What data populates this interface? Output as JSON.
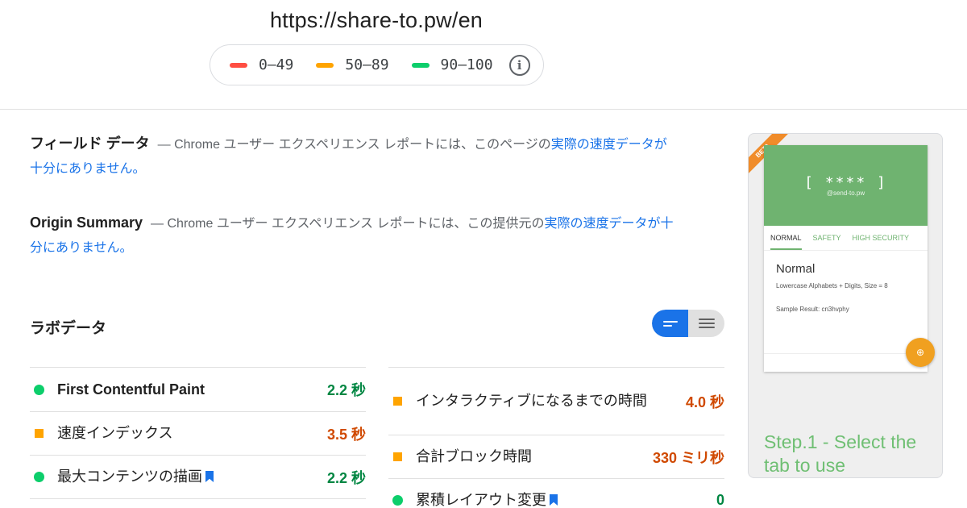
{
  "header": {
    "url": "https://share-to.pw/en"
  },
  "legend": {
    "items": [
      {
        "label": "0–49",
        "color": "#ff4e42"
      },
      {
        "label": "50–89",
        "color": "#ffa400"
      },
      {
        "label": "90–100",
        "color": "#0cce6b"
      }
    ],
    "info_icon_glyph": "i"
  },
  "field_data": {
    "title": "フィールド データ",
    "text": "— Chrome ユーザー エクスペリエンス レポートには、このページの",
    "link": "実際の速度データが十分にありません。"
  },
  "origin_summary": {
    "title": "Origin Summary",
    "text": "— Chrome ユーザー エクスペリエンス レポートには、この提供元の",
    "link": "実際の速度データが十分にありません。"
  },
  "lab_data": {
    "title": "ラボデータ"
  },
  "metrics_left": [
    {
      "name": "First Contentful Paint",
      "value": "2.2 秒",
      "status": "green",
      "bookmark": false
    },
    {
      "name": "速度インデックス",
      "value": "3.5 秒",
      "status": "orange",
      "bookmark": false
    },
    {
      "name": "最大コンテンツの描画",
      "value": "2.2 秒",
      "status": "green",
      "bookmark": true
    }
  ],
  "metrics_right": [
    {
      "name": "インタラクティブになるまでの時間",
      "value": "4.0 秒",
      "status": "orange",
      "bookmark": false
    },
    {
      "name": "合計ブロック時間",
      "value": "330 ミリ秒",
      "status": "orange",
      "bookmark": false
    },
    {
      "name": "累積レイアウト変更",
      "value": "0",
      "status": "green",
      "bookmark": true
    }
  ],
  "colors": {
    "accent": "#1a73e8",
    "green_text": "#018642",
    "orange_text": "#d04900",
    "green_dot": "#0cce6b",
    "orange_square": "#ffa400"
  },
  "thumbnail": {
    "beta": "BETA",
    "header_main": "[ **** ]",
    "header_sub": "@send-to.pw",
    "tabs": [
      "NORMAL",
      "SAFETY",
      "HIGH SECURITY"
    ],
    "card_title": "Normal",
    "card_desc": "Lowercase Alphabets + Digits, Size = 8",
    "card_sample": "Sample Result: cn3hvphy",
    "caption": "Step.1 - Select the tab to use"
  }
}
